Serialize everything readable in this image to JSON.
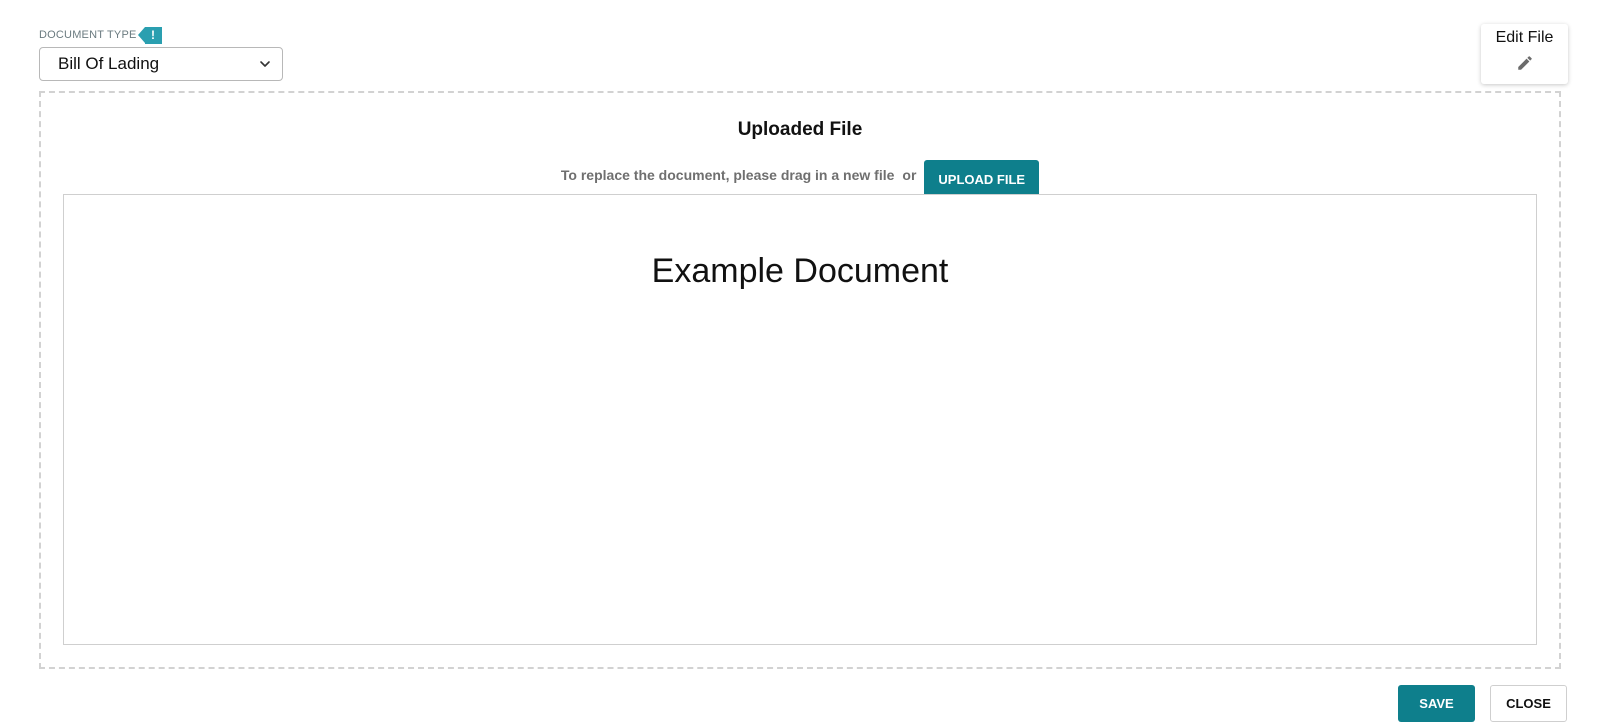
{
  "document_type": {
    "label": "DOCUMENT TYPE",
    "alert_badge": "!",
    "selected_value": "Bill Of Lading",
    "alert_color": "#2a9fb0"
  },
  "edit_file": {
    "label": "Edit File",
    "icon": "pencil-icon"
  },
  "dropzone": {
    "title": "Uploaded File",
    "instruction": "To replace the document, please drag in a new file",
    "or_text": "or",
    "upload_button": "UPLOAD FILE",
    "preview_title": "Example Document"
  },
  "footer": {
    "save_label": "SAVE",
    "close_label": "CLOSE"
  },
  "colors": {
    "accent": "#0e7f8c",
    "border": "#d2d2d2"
  }
}
